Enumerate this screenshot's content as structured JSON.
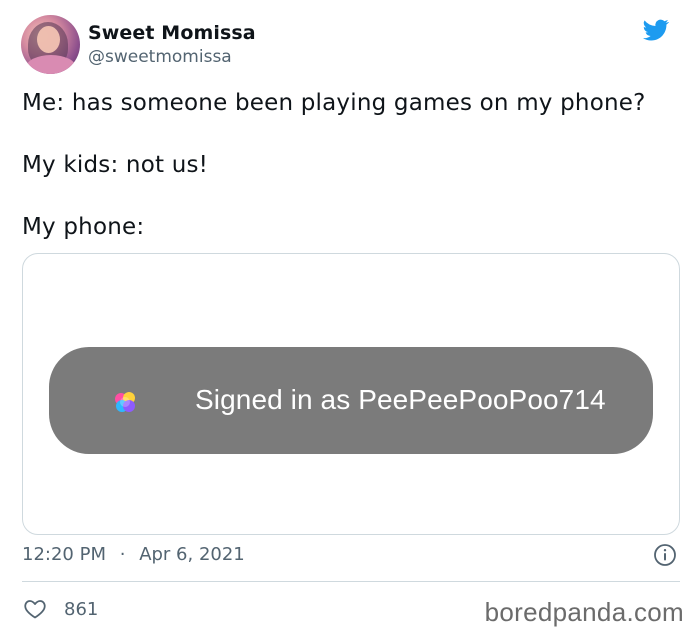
{
  "tweet": {
    "author": {
      "display_name": "Sweet Momissa",
      "handle": "@sweetmomissa"
    },
    "text_lines": [
      "Me: has someone been playing games on my phone?",
      "My kids: not us!",
      "My phone:"
    ],
    "media": {
      "banner_text": "Signed in as PeePeePooPoo714",
      "banner_icon": "game-center-icon"
    },
    "meta": {
      "time": "12:20 PM",
      "separator": "·",
      "date": "Apr 6, 2021"
    },
    "likes": "861"
  },
  "watermark": "boredpanda.com",
  "icons": {
    "brand": "twitter-bird-icon",
    "info": "info-icon",
    "like": "heart-icon"
  },
  "colors": {
    "twitter_blue": "#1d9bf0",
    "text_primary": "#0f1419",
    "text_secondary": "#536471",
    "border": "#cfd9de",
    "banner_gray": "#7b7b7b"
  }
}
